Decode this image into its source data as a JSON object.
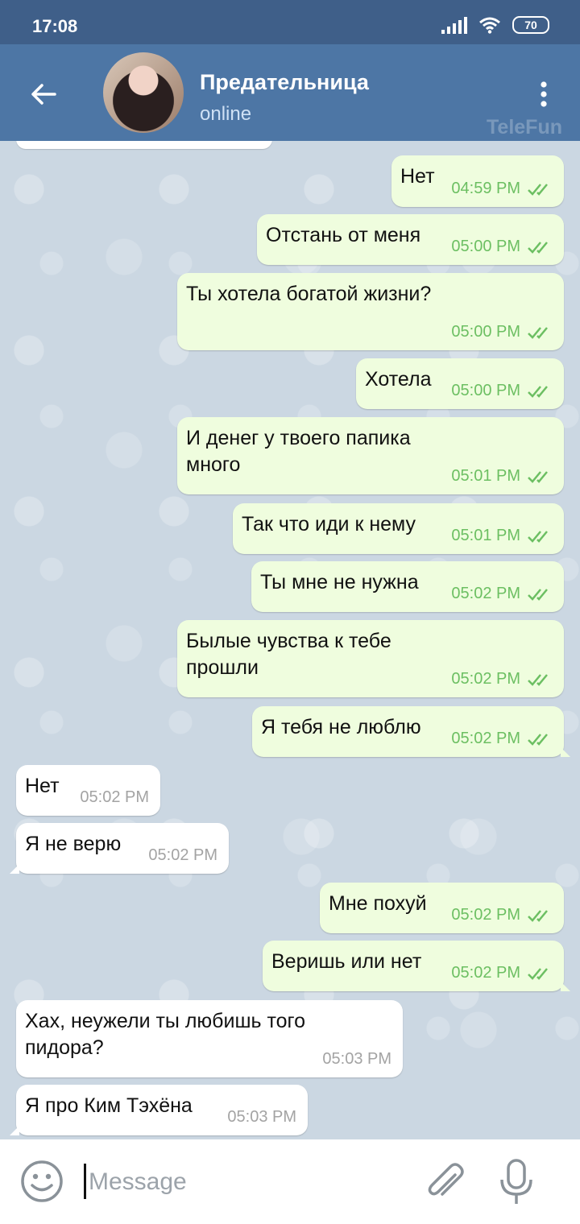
{
  "status_bar": {
    "time": "17:08",
    "battery": "70"
  },
  "header": {
    "name": "Предательница",
    "status": "online",
    "watermark": "TeleFun"
  },
  "colors": {
    "header": "#4d76a5",
    "status_bar": "#3f5f89",
    "outgoing": "#effdde",
    "incoming": "#ffffff",
    "read_ticks": "#6cbf62"
  },
  "messages": [
    {
      "dir": "out",
      "text": "Нет",
      "time": "04:59 PM"
    },
    {
      "dir": "out",
      "text": "Отстань от меня",
      "time": "05:00 PM"
    },
    {
      "dir": "out",
      "text": "Ты хотела богатой жизни?",
      "time": "05:00 PM"
    },
    {
      "dir": "out",
      "text": "Хотела",
      "time": "05:00 PM"
    },
    {
      "dir": "out",
      "text": "И денег у твоего папика\nмного",
      "time": "05:01 PM"
    },
    {
      "dir": "out",
      "text": "Так что иди к нему",
      "time": "05:01 PM"
    },
    {
      "dir": "out",
      "text": "Ты мне не нужна",
      "time": "05:02 PM"
    },
    {
      "dir": "out",
      "text": "Былые чувства к тебе\nпрошли",
      "time": "05:02 PM"
    },
    {
      "dir": "out",
      "text": "Я тебя не люблю",
      "time": "05:02 PM"
    },
    {
      "dir": "in",
      "text": "Нет",
      "time": "05:02 PM"
    },
    {
      "dir": "in",
      "text": "Я не верю",
      "time": "05:02 PM"
    },
    {
      "dir": "out",
      "text": "Мне похуй",
      "time": "05:02 PM"
    },
    {
      "dir": "out",
      "text": "Веришь или нет",
      "time": "05:02 PM"
    },
    {
      "dir": "in",
      "text": "Хах, неужели ты любишь того\nпидора?",
      "time": "05:03 PM"
    },
    {
      "dir": "in",
      "text": "Я про Ким Тэхёна",
      "time": "05:03 PM"
    }
  ],
  "input": {
    "placeholder": "Message",
    "value": ""
  }
}
